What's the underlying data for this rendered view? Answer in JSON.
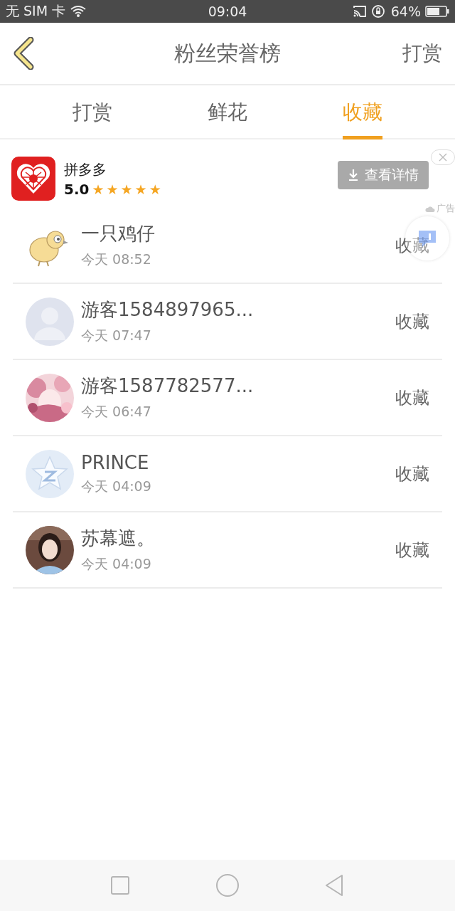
{
  "status_bar": {
    "carrier": "无 SIM 卡",
    "time": "09:04",
    "battery": "64%"
  },
  "header": {
    "title": "粉丝荣誉榜",
    "action": "打赏"
  },
  "tabs": [
    {
      "label": "打赏",
      "selected": false
    },
    {
      "label": "鲜花",
      "selected": false
    },
    {
      "label": "收藏",
      "selected": true
    }
  ],
  "ad": {
    "app_name": "拼多多",
    "rating": "5.0",
    "stars": 5,
    "button": "查看详情",
    "tag": "广告"
  },
  "fans": [
    {
      "name": "一只鸡仔",
      "time": "今天 08:52",
      "action": "收藏"
    },
    {
      "name": "游客1584897965...",
      "time": "今天 07:47",
      "action": "收藏"
    },
    {
      "name": "游客1587782577...",
      "time": "今天 06:47",
      "action": "收藏"
    },
    {
      "name": "PRINCE",
      "time": "今天 04:09",
      "action": "收藏"
    },
    {
      "name": "苏幕遮。",
      "time": "今天 04:09",
      "action": "收藏"
    }
  ]
}
